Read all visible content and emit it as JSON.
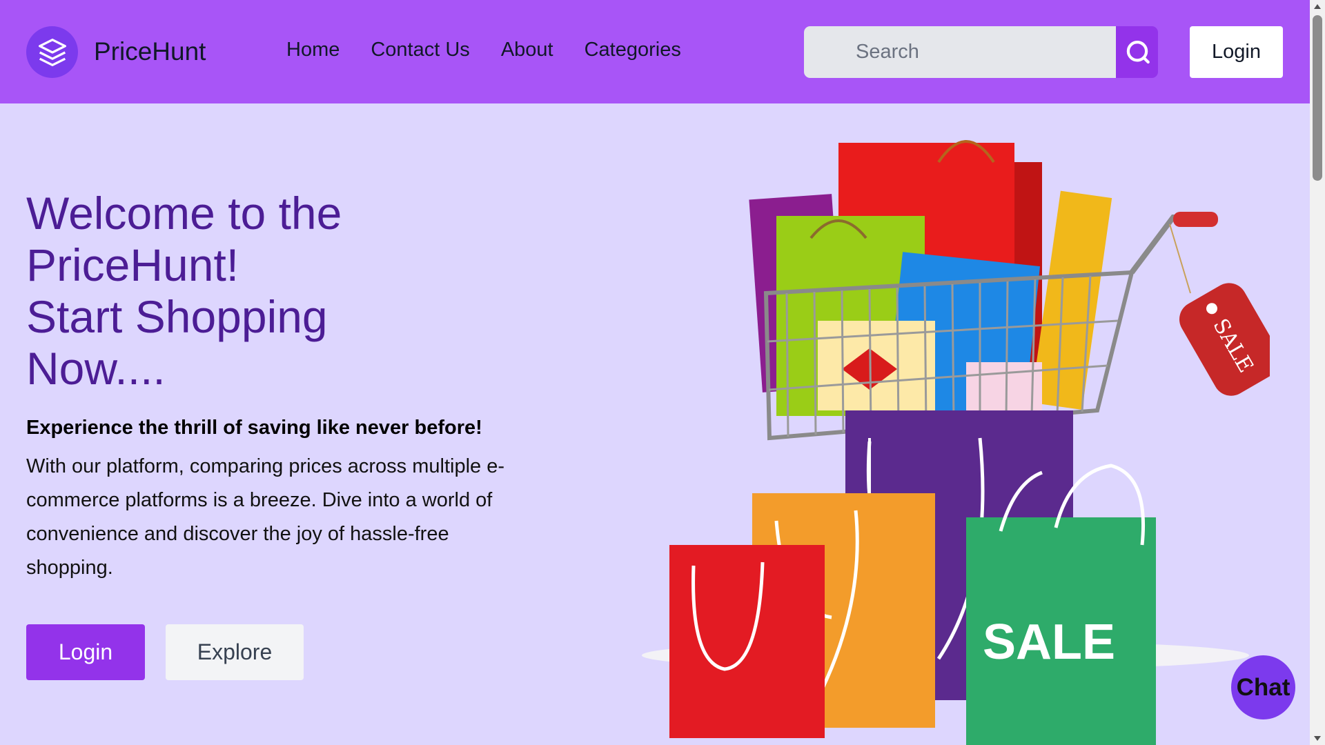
{
  "header": {
    "brand": "PriceHunt",
    "nav": [
      "Home",
      "Contact Us",
      "About",
      "Categories"
    ],
    "search_placeholder": "Search",
    "login_label": "Login"
  },
  "hero": {
    "title_lines": [
      "Welcome to the",
      "PriceHunt!",
      "Start Shopping",
      "Now...."
    ],
    "lead": "Experience the thrill of saving like never before!",
    "body": "With our platform, comparing prices across multiple e-commerce platforms is a breeze. Dive into a world of convenience and discover the joy of hassle-free shopping.",
    "login_button": "Login",
    "explore_button": "Explore"
  },
  "illustration": {
    "tag_text": "SALE",
    "bag_text": "SALE"
  },
  "chat": {
    "label": "Chat"
  },
  "icons": {
    "logo": "layers-icon",
    "search": "search-icon",
    "cart": "shopping-cart-icon"
  },
  "colors": {
    "header_bg": "#a855f7",
    "page_bg": "#ddd6fe",
    "accent": "#9333ea",
    "title": "#4c1d95"
  }
}
